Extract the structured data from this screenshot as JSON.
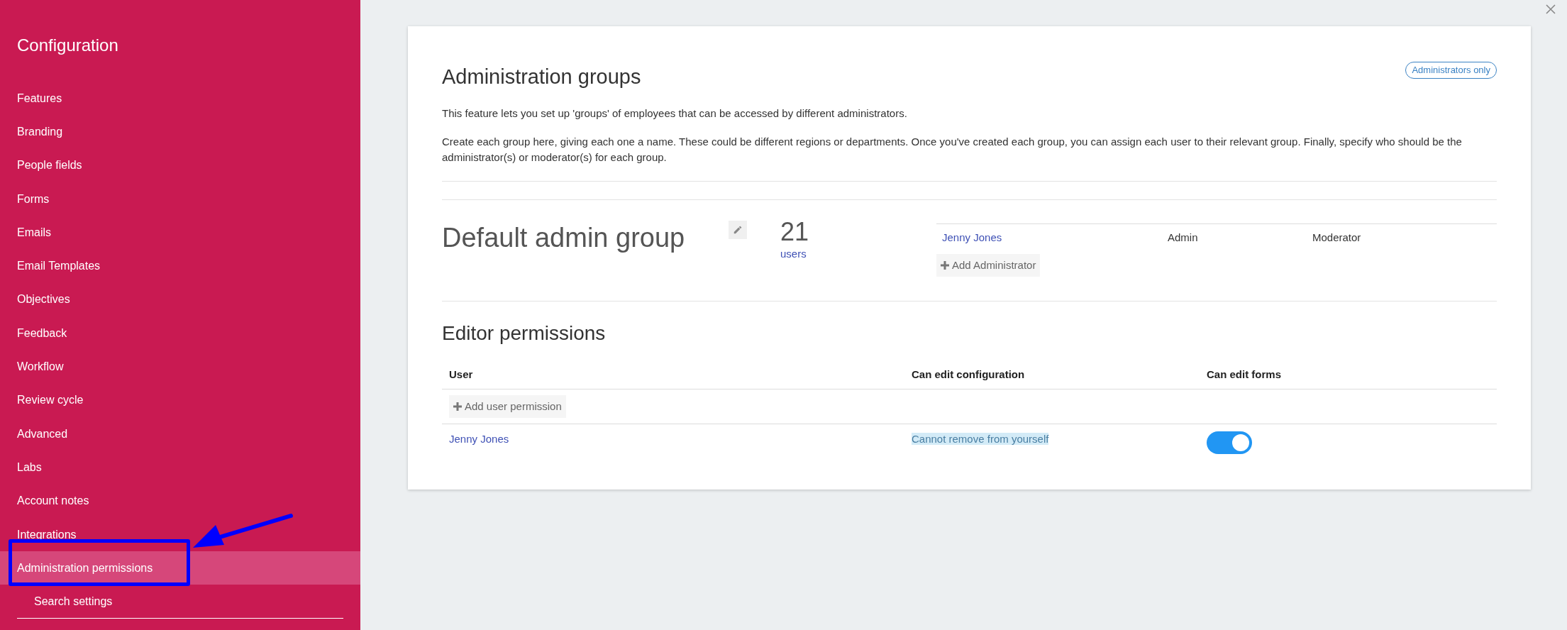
{
  "sidebar": {
    "title": "Configuration",
    "items": [
      {
        "label": "Features",
        "selected": false
      },
      {
        "label": "Branding",
        "selected": false
      },
      {
        "label": "People fields",
        "selected": false
      },
      {
        "label": "Forms",
        "selected": false
      },
      {
        "label": "Emails",
        "selected": false
      },
      {
        "label": "Email Templates",
        "selected": false
      },
      {
        "label": "Objectives",
        "selected": false
      },
      {
        "label": "Feedback",
        "selected": false
      },
      {
        "label": "Workflow",
        "selected": false
      },
      {
        "label": "Review cycle",
        "selected": false
      },
      {
        "label": "Advanced",
        "selected": false
      },
      {
        "label": "Labs",
        "selected": false
      },
      {
        "label": "Account notes",
        "selected": false
      },
      {
        "label": "Integrations",
        "selected": false
      },
      {
        "label": "Administration permissions",
        "selected": true
      },
      {
        "label": "Search settings",
        "selected": false
      }
    ]
  },
  "card": {
    "title": "Administration groups",
    "badge": "Administrators only",
    "paragraphs": [
      "This feature lets you set up 'groups' of employees that can be accessed by different administrators.",
      "Create each group here, giving each one a name. These could be different regions or departments. Once you've created each group, you can assign each user to their relevant group. Finally, specify who should be the administrator(s) or moderator(s) for each group."
    ],
    "group": {
      "name": "Default admin group",
      "count": "21",
      "count_label": "users",
      "administrators": [
        {
          "name": "Jenny Jones",
          "role_1": "Admin",
          "role_2": "Moderator"
        }
      ],
      "add_button": "Add Administrator"
    },
    "editor_permissions": {
      "title": "Editor permissions",
      "columns": [
        "User",
        "Can edit configuration",
        "Can edit forms"
      ],
      "add_button": "Add user permission",
      "rows": [
        {
          "user": "Jenny Jones",
          "configuration_note": "Cannot remove from yourself",
          "can_edit_forms": {
            "on": true
          }
        }
      ]
    }
  }
}
